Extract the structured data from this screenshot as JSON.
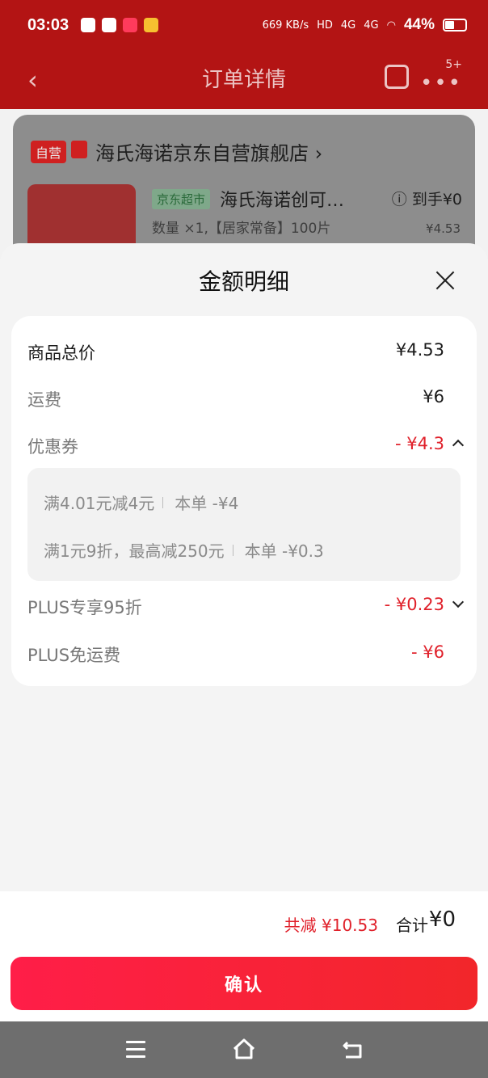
{
  "status_bar": {
    "time": "03:03",
    "network_speed": "669 KB/s",
    "hd": "HD",
    "signal1": "4G",
    "signal2": "4G",
    "battery": "44%"
  },
  "header": {
    "title": "订单详情",
    "more_badge": "5+"
  },
  "order_card": {
    "shop_tag": "自营",
    "shop_name": "海氏海诺京东自营旗舰店 ›",
    "product_tag": "京东超市",
    "product_name": "海氏海诺创可…",
    "product_spec": "数量 ×1,【居家常备】100片",
    "net_price": "ⓘ 到手¥0",
    "unit_price": "¥4.53"
  },
  "sheet": {
    "title": "金额明细",
    "rows": [
      {
        "label": "商品总价",
        "value": "¥4.53"
      },
      {
        "label": "运费",
        "value": "¥6"
      },
      {
        "label": "优惠券",
        "value": "- ¥4.3"
      },
      {
        "label": "PLUS专享95折",
        "value": "- ¥0.23"
      },
      {
        "label": "PLUS免运费",
        "value": "- ¥6"
      }
    ],
    "coupons": [
      {
        "rule": "满4.01元减4元",
        "applied": "本单 -¥4"
      },
      {
        "rule": "满1元9折，最高减250元",
        "applied": "本单 -¥0.3"
      }
    ]
  },
  "summary": {
    "saved": "共减 ¥10.53",
    "total_label": "合计",
    "total_value": "¥0"
  },
  "confirm_label": "确认",
  "colors": {
    "accent_red": "#e0202a",
    "button_gradient_start": "#ff1e48",
    "button_gradient_end": "#f2262a"
  }
}
